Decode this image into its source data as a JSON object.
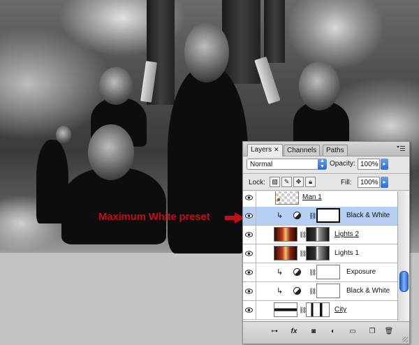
{
  "annotation": {
    "text": "Maximum White preset",
    "color": "#c20d1a"
  },
  "panel": {
    "tabs": [
      {
        "label": "Layers",
        "active": true
      },
      {
        "label": "Channels",
        "active": false
      },
      {
        "label": "Paths",
        "active": false
      }
    ],
    "close_glyph": "✕",
    "blend_mode": "Normal",
    "opacity_label": "Opacity:",
    "opacity_value": "100%",
    "lock_label": "Lock:",
    "fill_label": "Fill:",
    "fill_value": "100%",
    "layers": [
      {
        "name": "Man 1",
        "type": "pixel",
        "visible": true,
        "selected": false,
        "clipped": false,
        "has_mask": false
      },
      {
        "name": "Black & White",
        "type": "adjustment",
        "visible": true,
        "selected": true,
        "clipped": true,
        "has_mask": true
      },
      {
        "name": "Lights 2",
        "type": "pixel",
        "visible": true,
        "selected": false,
        "clipped": false,
        "has_mask": true
      },
      {
        "name": "Lights 1",
        "type": "pixel",
        "visible": true,
        "selected": false,
        "clipped": false,
        "has_mask": true
      },
      {
        "name": "Exposure",
        "type": "adjustment",
        "visible": true,
        "selected": false,
        "clipped": true,
        "has_mask": true
      },
      {
        "name": "Black & White",
        "type": "adjustment",
        "visible": true,
        "selected": false,
        "clipped": true,
        "has_mask": true
      },
      {
        "name": "City",
        "type": "pixel",
        "visible": true,
        "selected": false,
        "clipped": false,
        "has_mask": true
      }
    ],
    "bottom_buttons": [
      {
        "name": "link-layers-icon",
        "glyph": "⊶"
      },
      {
        "name": "layer-style-icon",
        "glyph": "fx"
      },
      {
        "name": "add-mask-icon",
        "glyph": "◙"
      },
      {
        "name": "new-adjustment-icon",
        "glyph": "◐"
      },
      {
        "name": "new-group-icon",
        "glyph": "▭"
      },
      {
        "name": "new-layer-icon",
        "glyph": "❐"
      },
      {
        "name": "delete-layer-icon",
        "glyph": "🗑"
      }
    ]
  },
  "colors": {
    "selection": "#b5d0f4",
    "accent_blue": "#2c6bd0"
  }
}
